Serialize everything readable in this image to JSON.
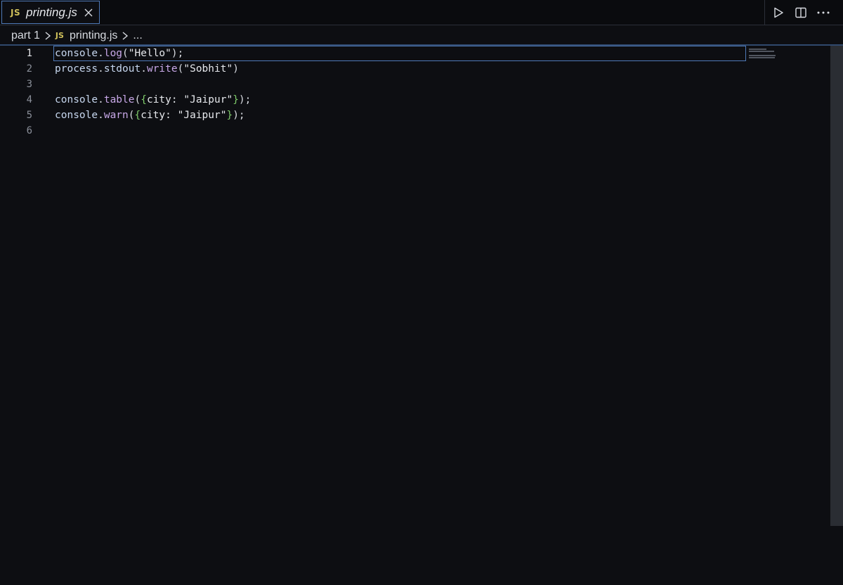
{
  "tab": {
    "language_badge": "JS",
    "filename": "printing.js",
    "close_icon": "close-icon"
  },
  "toolbar": {
    "run_icon": "play-icon",
    "split_icon": "split-editor-icon",
    "more_icon": "more-actions-icon"
  },
  "breadcrumb": {
    "folder": "part 1",
    "file_badge": "JS",
    "file": "printing.js",
    "ellipsis": "..."
  },
  "editor": {
    "active_line": 1,
    "line_numbers": [
      "1",
      "2",
      "3",
      "4",
      "5",
      "6"
    ],
    "lines": [
      [
        [
          "obj",
          "console"
        ],
        [
          "punc",
          "."
        ],
        [
          "fn",
          "log"
        ],
        [
          "punc",
          "("
        ],
        [
          "str",
          "\"Hello\""
        ],
        [
          "punc",
          ");"
        ]
      ],
      [
        [
          "obj",
          "process"
        ],
        [
          "punc",
          "."
        ],
        [
          "obj",
          "stdout"
        ],
        [
          "punc",
          "."
        ],
        [
          "fn",
          "write"
        ],
        [
          "punc",
          "("
        ],
        [
          "str",
          "\"Sobhit\""
        ],
        [
          "punc",
          ")"
        ]
      ],
      [],
      [
        [
          "obj",
          "console"
        ],
        [
          "punc",
          "."
        ],
        [
          "fn",
          "table"
        ],
        [
          "punc",
          "("
        ],
        [
          "brace",
          "{"
        ],
        [
          "key",
          "city: "
        ],
        [
          "str",
          "\"Jaipur\""
        ],
        [
          "brace",
          "}"
        ],
        [
          "punc",
          ");"
        ]
      ],
      [
        [
          "obj",
          "console"
        ],
        [
          "punc",
          "."
        ],
        [
          "fn",
          "warn"
        ],
        [
          "punc",
          "("
        ],
        [
          "brace",
          "{"
        ],
        [
          "key",
          "city: "
        ],
        [
          "str",
          "\"Jaipur\""
        ],
        [
          "brace",
          "}"
        ],
        [
          "punc",
          ");"
        ]
      ],
      []
    ]
  },
  "colors": {
    "background": "#0d0e12",
    "accent_border": "#4f7ab8",
    "js_badge": "#cfc05a",
    "function": "#c8a8e8",
    "brace": "#7ecb6a"
  }
}
